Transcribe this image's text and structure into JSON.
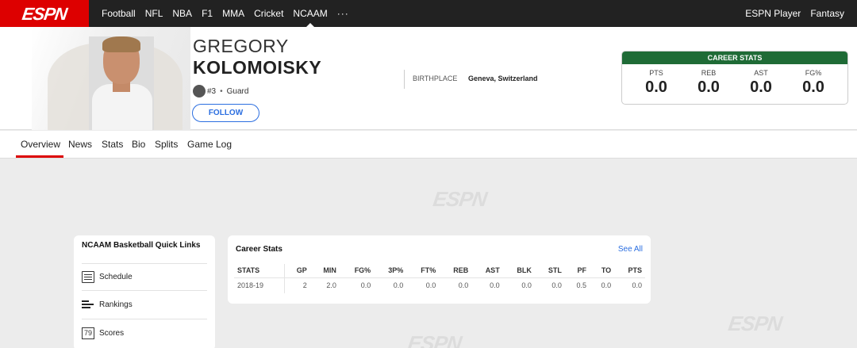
{
  "nav": {
    "logo": "ESPN",
    "items": [
      "Football",
      "NFL",
      "NBA",
      "F1",
      "MMA",
      "Cricket",
      "NCAAM"
    ],
    "active": "NCAAM",
    "more": "···",
    "right": [
      "ESPN Player",
      "Fantasy"
    ]
  },
  "player": {
    "first_name": "GREGORY",
    "last_name": "KOLOMOISKY",
    "number": "#3",
    "separator": "•",
    "position": "Guard",
    "follow_label": "FOLLOW",
    "birthplace_label": "BIRTHPLACE",
    "birthplace": "Geneva, Switzerland"
  },
  "career_summary": {
    "title": "CAREER STATS",
    "stats": [
      {
        "label": "PTS",
        "value": "0.0"
      },
      {
        "label": "REB",
        "value": "0.0"
      },
      {
        "label": "AST",
        "value": "0.0"
      },
      {
        "label": "FG%",
        "value": "0.0"
      }
    ],
    "color": "#1f6b36"
  },
  "subnav": {
    "items": [
      "Overview",
      "News",
      "Stats",
      "Bio",
      "Splits",
      "Game Log"
    ],
    "active": "Overview"
  },
  "watermark": "ESPN",
  "quick_links": {
    "title": "NCAAM Basketball Quick Links",
    "items": [
      {
        "label": "Schedule",
        "icon": "calendar-icon"
      },
      {
        "label": "Rankings",
        "icon": "rankings-icon"
      },
      {
        "label": "Scores",
        "icon": "scores-icon"
      }
    ]
  },
  "career_stats": {
    "title": "Career Stats",
    "see_all": "See All",
    "columns": [
      "STATS",
      "GP",
      "MIN",
      "FG%",
      "3P%",
      "FT%",
      "REB",
      "AST",
      "BLK",
      "STL",
      "PF",
      "TO",
      "PTS"
    ],
    "rows": [
      [
        "2018-19",
        "2",
        "2.0",
        "0.0",
        "0.0",
        "0.0",
        "0.0",
        "0.0",
        "0.0",
        "0.0",
        "0.5",
        "0.0",
        "0.0"
      ]
    ]
  },
  "colors": {
    "brand": "#d00000",
    "link": "#2b6ee0"
  }
}
